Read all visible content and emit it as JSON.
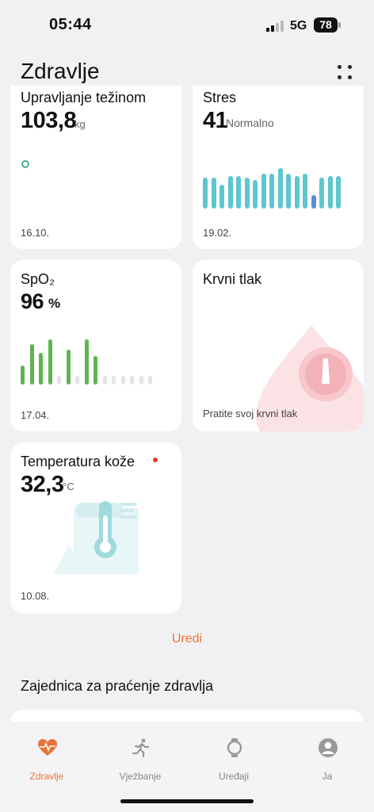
{
  "status_bar": {
    "time": "05:44",
    "network": "5G",
    "battery": "78"
  },
  "header": {
    "title": "Zdravlje"
  },
  "cards": {
    "weight": {
      "title": "Upravljanje težinom",
      "value": "103,8",
      "unit": "kg",
      "date": "16.10."
    },
    "stress": {
      "title": "Stres",
      "value": "41",
      "status": "Normalno",
      "date": "19.02.",
      "bar_levels": [
        0.7,
        0.7,
        0.55,
        0.75,
        0.75,
        0.7,
        0.65,
        0.8,
        0.8,
        0.92,
        0.8,
        0.75,
        0.8,
        0.3,
        0.7,
        0.75,
        0.75
      ],
      "highlight_index": 13
    },
    "spo2": {
      "title": "SpO₂",
      "value": "96",
      "unit": "%",
      "date": "17.04.",
      "bar_levels": [
        0.42,
        0.9,
        0.7,
        1.0,
        0.2,
        0.78,
        0.2,
        1.0,
        0.63,
        0.2,
        0.2,
        0.2,
        0.2,
        0.2,
        0.2
      ],
      "bar_active": [
        true,
        true,
        true,
        true,
        false,
        true,
        false,
        true,
        true,
        false,
        false,
        false,
        false,
        false,
        false
      ]
    },
    "blood_pressure": {
      "title": "Krvni tlak",
      "hint": "Pratite svoj krvni tlak"
    },
    "skin_temp": {
      "title": "Temperatura kože",
      "value": "32,3",
      "unit": "°C",
      "date": "10.08."
    }
  },
  "edit_label": "Uredi",
  "community_title": "Zajednica za praćenje zdravlja",
  "tabs": [
    {
      "label": "Zdravlje",
      "icon": "heart-pulse-icon",
      "active": true
    },
    {
      "label": "Vježbanje",
      "icon": "running-person-icon",
      "active": false
    },
    {
      "label": "Uređaji",
      "icon": "watch-icon",
      "active": false
    },
    {
      "label": "Ja",
      "icon": "profile-icon",
      "active": false
    }
  ],
  "colors": {
    "accent": "#e8743b",
    "stress_bar": "#5dc6cf",
    "stress_highlight": "#5b8ed8",
    "spo2_bar": "#5db54f",
    "spo2_inactive": "#e4e4e4"
  }
}
